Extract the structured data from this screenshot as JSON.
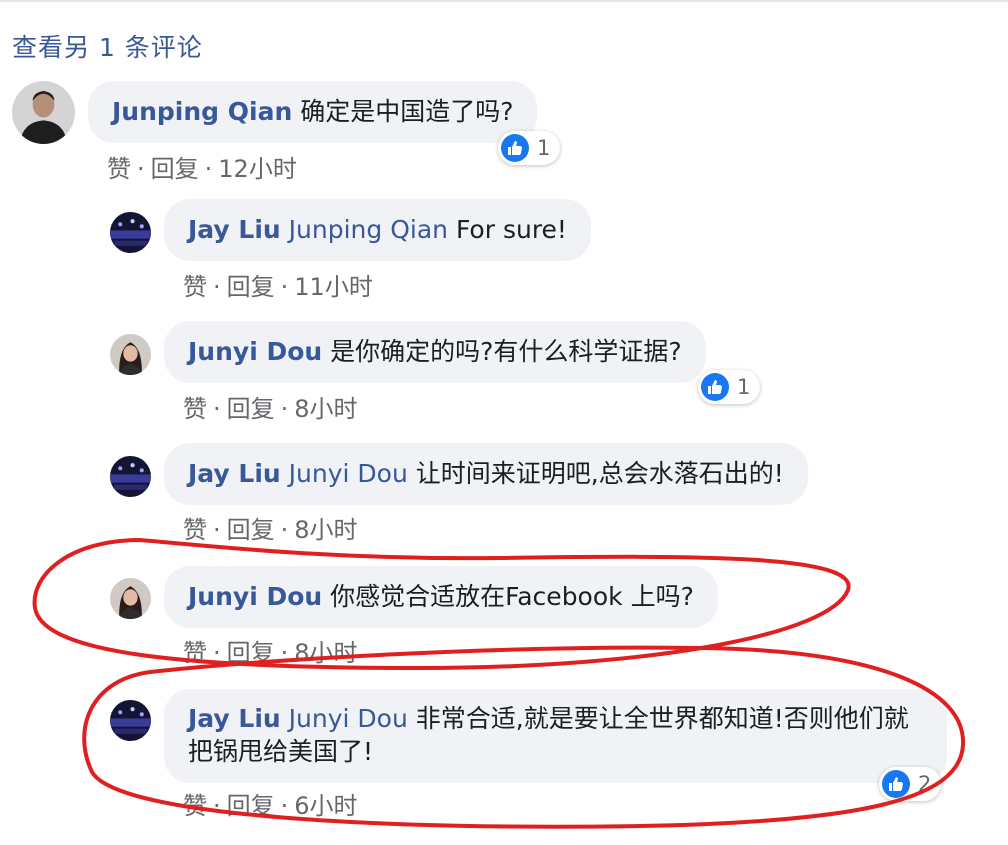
{
  "view_more": "查看另 1 条评论",
  "actions": {
    "like": "赞",
    "reply": "回复"
  },
  "colors": {
    "link": "#385898",
    "bubble": "#f0f2f5",
    "meta": "#65676b",
    "like_blue": "#1877f2",
    "annotation_red": "#e02020"
  },
  "comments": [
    {
      "author": "Junping Qian",
      "mention": "",
      "text": "确定是中国造了吗?",
      "time": "12小时",
      "likes": "1",
      "avatar_icon": "male-portrait-avatar"
    },
    {
      "author": "Jay Liu",
      "mention": "Junping Qian",
      "text": "For sure!",
      "time": "11小时",
      "likes": "",
      "avatar_icon": "concert-stage-avatar"
    },
    {
      "author": "Junyi Dou",
      "mention": "",
      "text": "是你确定的吗?有什么科学证据?",
      "time": "8小时",
      "likes": "1",
      "avatar_icon": "female-portrait-avatar"
    },
    {
      "author": "Jay Liu",
      "mention": "Junyi Dou",
      "text": "让时间来证明吧,总会水落石出的!",
      "time": "8小时",
      "likes": "",
      "avatar_icon": "concert-stage-avatar"
    },
    {
      "author": "Junyi Dou",
      "mention": "",
      "text": "你感觉合适放在Facebook 上吗?",
      "time": "8小时",
      "likes": "",
      "avatar_icon": "female-portrait-avatar"
    },
    {
      "author": "Jay Liu",
      "mention": "Junyi Dou",
      "text": "非常合适,就是要让全世界都知道!否则他们就把锅甩给美国了!",
      "time": "6小时",
      "likes": "2",
      "avatar_icon": "concert-stage-avatar"
    }
  ]
}
